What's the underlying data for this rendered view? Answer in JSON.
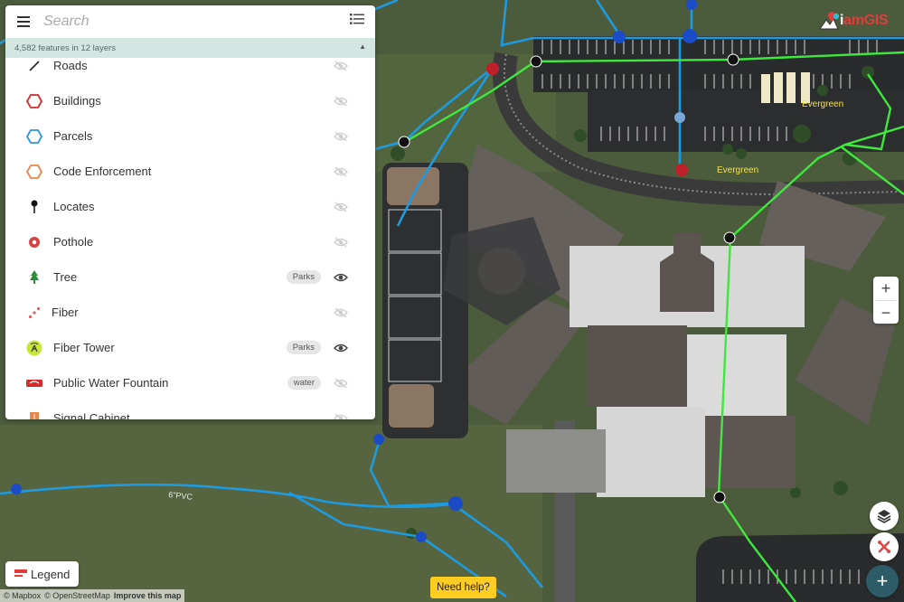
{
  "map": {
    "labels": {
      "evergreen_1": "Evergreen",
      "evergreen_2": "Evergreen",
      "pipe": "6\"PVC"
    }
  },
  "search": {
    "placeholder": "Search"
  },
  "summary": {
    "text": "4,582 features in 12 layers"
  },
  "layers": [
    {
      "label": "Roads",
      "tag": "",
      "visible": false,
      "icon": "road-line-icon",
      "color": "#222222"
    },
    {
      "label": "Buildings",
      "tag": "",
      "visible": false,
      "icon": "hexagon-outline-icon",
      "color": "#d42a2a"
    },
    {
      "label": "Parcels",
      "tag": "",
      "visible": false,
      "icon": "hexagon-outline-icon",
      "color": "#2a96d9"
    },
    {
      "label": "Code Enforcement",
      "tag": "",
      "visible": false,
      "icon": "hexagon-outline-icon",
      "color": "#e8864a"
    },
    {
      "label": "Locates",
      "tag": "",
      "visible": false,
      "icon": "pin-icon",
      "color": "#111111"
    },
    {
      "label": "Pothole",
      "tag": "",
      "visible": false,
      "icon": "pothole-icon",
      "color": "#d94040"
    },
    {
      "label": "Tree",
      "tag": "Parks",
      "visible": true,
      "icon": "tree-icon",
      "color": "#2e8b3a"
    },
    {
      "label": "Fiber",
      "tag": "",
      "visible": false,
      "icon": "dashed-line-icon",
      "color": "#e65a5a"
    },
    {
      "label": "Fiber Tower",
      "tag": "Parks",
      "visible": true,
      "icon": "tower-icon",
      "color": "#c8e63a"
    },
    {
      "label": "Public Water Fountain",
      "tag": "water",
      "visible": false,
      "icon": "fountain-icon",
      "color": "#d42a2a"
    },
    {
      "label": "Signal Cabinet",
      "tag": "",
      "visible": false,
      "icon": "cabinet-icon",
      "color": "#e8864a"
    }
  ],
  "logo": {
    "text_pre": "i",
    "text_main": "amGIS"
  },
  "zoom": {
    "in": "+",
    "out": "−"
  },
  "buttons": {
    "legend": "Legend",
    "help": "Need help?",
    "add": "+"
  },
  "attribution": {
    "mapbox": "© Mapbox",
    "osm": "© OpenStreetMap",
    "improve": "Improve this map"
  },
  "colors": {
    "water_line": "#1e9be0",
    "sewer_line": "#3ee83e",
    "grass": "#4b5a3a",
    "parking": "#2c2d2f",
    "roof": "#dcdcdc",
    "help": "#ffcc22",
    "fab": "#2d5c68"
  }
}
